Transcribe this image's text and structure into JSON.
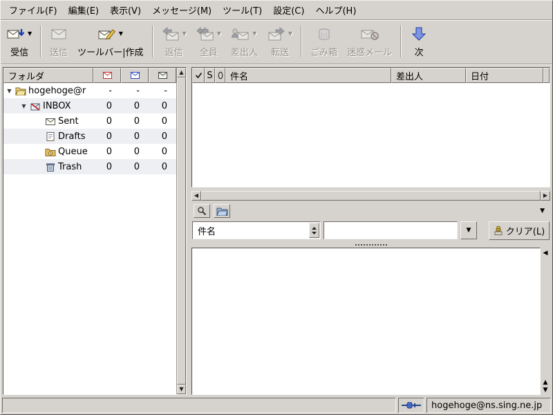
{
  "colors": {
    "background": "#d6d3ce",
    "accent_blue": "#3a62c8",
    "disabled_text": "#97938c"
  },
  "menubar": {
    "items": [
      "ファイル(F)",
      "編集(E)",
      "表示(V)",
      "メッセージ(M)",
      "ツール(T)",
      "設定(C)",
      "ヘルプ(H)"
    ]
  },
  "toolbar": {
    "buttons": [
      {
        "label": "受信",
        "enabled": true,
        "dropdown": true,
        "icon": "receive-mail-icon"
      },
      {
        "label": "送信",
        "enabled": false,
        "dropdown": false,
        "icon": "send-mail-icon"
      },
      {
        "label": "ツールバー|作成",
        "enabled": true,
        "dropdown": true,
        "icon": "compose-mail-icon"
      },
      {
        "label": "返信",
        "enabled": false,
        "dropdown": true,
        "icon": "reply-icon"
      },
      {
        "label": "全員",
        "enabled": false,
        "dropdown": true,
        "icon": "reply-all-icon"
      },
      {
        "label": "差出人",
        "enabled": false,
        "dropdown": true,
        "icon": "reply-sender-icon"
      },
      {
        "label": "転送",
        "enabled": false,
        "dropdown": true,
        "icon": "forward-icon"
      },
      {
        "label": "ごみ箱",
        "enabled": false,
        "dropdown": false,
        "icon": "trash-icon"
      },
      {
        "label": "迷惑メール",
        "enabled": false,
        "dropdown": false,
        "icon": "junk-mail-icon"
      },
      {
        "label": "次",
        "enabled": true,
        "dropdown": false,
        "icon": "next-icon"
      }
    ]
  },
  "folder_pane": {
    "header": {
      "label": "フォルダ",
      "count_columns": [
        "unread-envelope-icon",
        "new-envelope-icon",
        "total-envelope-icon"
      ]
    },
    "rows": [
      {
        "label": "hogehoge@r",
        "counts": [
          "-",
          "-",
          "-"
        ],
        "level": 0,
        "expanded": true,
        "icon": "account-folder-icon"
      },
      {
        "label": "INBOX",
        "counts": [
          "0",
          "0",
          "0"
        ],
        "level": 1,
        "expanded": true,
        "icon": "inbox-folder-icon"
      },
      {
        "label": "Sent",
        "counts": [
          "0",
          "0",
          "0"
        ],
        "level": 2,
        "expanded": false,
        "icon": "sent-folder-icon"
      },
      {
        "label": "Drafts",
        "counts": [
          "0",
          "0",
          "0"
        ],
        "level": 2,
        "expanded": false,
        "icon": "drafts-folder-icon"
      },
      {
        "label": "Queue",
        "counts": [
          "0",
          "0",
          "0"
        ],
        "level": 2,
        "expanded": false,
        "icon": "queue-folder-icon"
      },
      {
        "label": "Trash",
        "counts": [
          "0",
          "0",
          "0"
        ],
        "level": 2,
        "expanded": false,
        "icon": "trash-folder-icon"
      }
    ]
  },
  "message_list": {
    "columns": [
      {
        "label": "",
        "icon": "check-mark-icon"
      },
      {
        "label": "S",
        "icon": ""
      },
      {
        "label": "",
        "icon": "paperclip-icon"
      },
      {
        "label": "件名",
        "icon": ""
      },
      {
        "label": "差出人",
        "icon": ""
      },
      {
        "label": "日付",
        "icon": ""
      }
    ],
    "rows": []
  },
  "quick_search": {
    "field_selector": "件名",
    "query": "",
    "clear_label": "クリア(L)"
  },
  "statusbar": {
    "status_text": "",
    "account": "hogehoge@ns.sing.ne.jp"
  }
}
